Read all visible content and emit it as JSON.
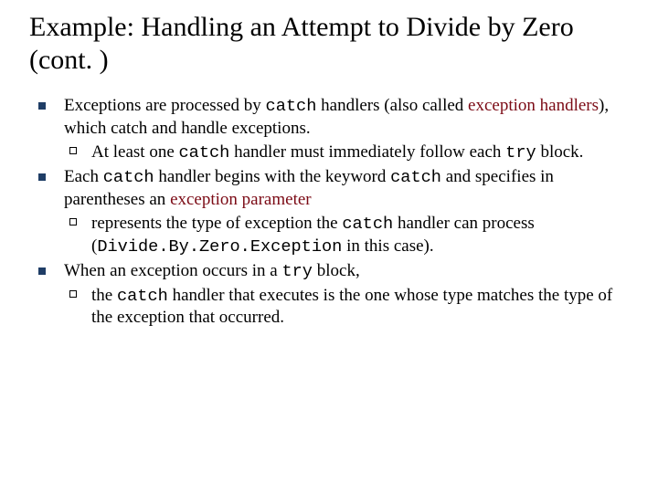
{
  "title": "Example: Handling an Attempt to Divide by Zero (cont. )",
  "b1": {
    "pre": "Exceptions are processed by ",
    "code1": "catch",
    "mid": " handlers (also called ",
    "term": "exception handlers",
    "post": "), which catch and handle exceptions."
  },
  "b1s1": {
    "pre": "At least one ",
    "code1": "catch",
    "mid": " handler must immediately follow each ",
    "code2": "try",
    "post": " block."
  },
  "b2": {
    "pre": "Each ",
    "code1": "catch",
    "mid": " handler begins with the keyword ",
    "code2": "catch",
    "post1": " and specifies in parentheses an ",
    "term": "exception parameter",
    "post2": ""
  },
  "b2s1": {
    "pre": "represents the type of exception the ",
    "code1": "catch",
    "mid": " handler can process (",
    "code2": "Divide.By.Zero.Exception",
    "post": " in this case)."
  },
  "b3": {
    "pre": "When an exception occurs in a ",
    "code1": "try",
    "post": " block,"
  },
  "b3s1": {
    "pre": "the ",
    "code1": "catch",
    "post": " handler that executes is the one whose type matches the type of the exception that occurred."
  }
}
